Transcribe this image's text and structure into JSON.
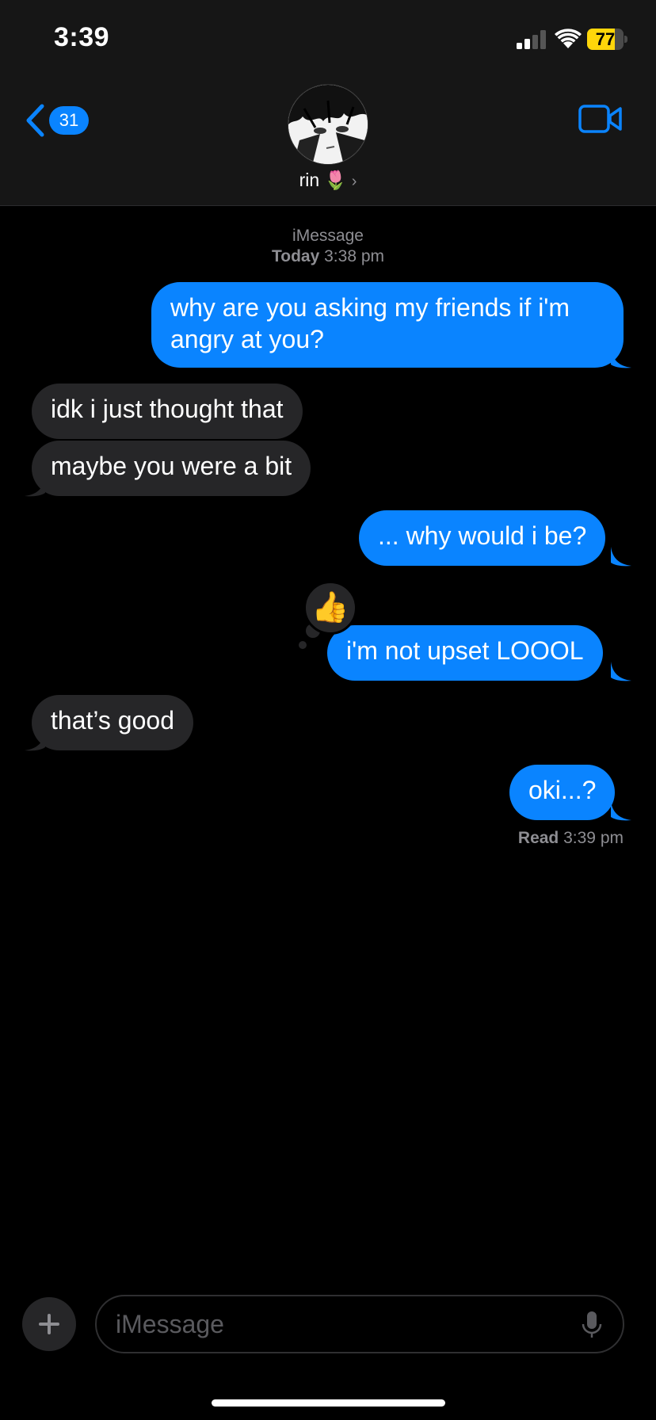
{
  "status_bar": {
    "time": "3:39",
    "battery": "77",
    "battery_level": 0.77,
    "signal_bars": 2
  },
  "header": {
    "back_badge": "31",
    "contact_name": "rin",
    "contact_emoji": "🌷",
    "chevron": "›"
  },
  "conversation": {
    "service": "iMessage",
    "date_label": "Today",
    "date_time": "3:38 pm",
    "messages": [
      {
        "from": "me",
        "text": "why are you asking my friends if i'm",
        "text2": "angry at you?"
      },
      {
        "from": "them",
        "text": "idk i just thought that"
      },
      {
        "from": "them",
        "text": "maybe you were a bit"
      },
      {
        "from": "me",
        "text": "... why would i be?"
      },
      {
        "from": "me",
        "text": "i'm not upset LOOOL",
        "tapback": "👍"
      },
      {
        "from": "them",
        "text": "that’s good"
      },
      {
        "from": "me",
        "text": "oki...?"
      }
    ],
    "read_label": "Read",
    "read_time": "3:39 pm"
  },
  "composer": {
    "placeholder": "iMessage"
  },
  "colors": {
    "sent": "#0a84ff",
    "received": "#262628",
    "background": "#000000",
    "header": "#161616",
    "battery": "#ffd60a"
  }
}
